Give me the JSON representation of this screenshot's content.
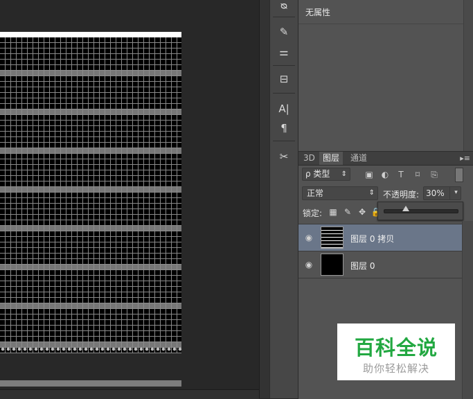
{
  "canvas": {
    "stripe_rows": 9
  },
  "tools": [
    {
      "icon": "history-brush-icon",
      "glyph": "ᴓ"
    },
    {
      "icon": "brush-presets-icon",
      "glyph": "✎"
    },
    {
      "icon": "adjust-sliders-icon",
      "glyph": "⚌"
    },
    {
      "icon": "clone-source-icon",
      "glyph": "⊟"
    },
    {
      "icon": "character-icon",
      "glyph": "A|"
    },
    {
      "icon": "paragraph-icon",
      "glyph": "¶"
    },
    {
      "icon": "tool-presets-icon",
      "glyph": "✂"
    }
  ],
  "properties": {
    "title": "无属性"
  },
  "layers_panel": {
    "tabs": [
      {
        "label": "3D",
        "active": false
      },
      {
        "label": "图层",
        "active": true
      },
      {
        "label": "通道",
        "active": false
      }
    ],
    "filter": {
      "label": "ρ 类型",
      "arrow": "⇕"
    },
    "filter_icons": [
      "image-filter-icon",
      "adjustment-filter-icon",
      "type-filter-icon",
      "shape-filter-icon",
      "smart-object-filter-icon"
    ],
    "blend_mode": {
      "value": "正常",
      "arrow": "⇕"
    },
    "opacity": {
      "label": "不透明度:",
      "value": "30%",
      "arrow": "▾",
      "fraction": 0.3
    },
    "lock": {
      "label": "锁定:"
    },
    "layers": [
      {
        "name": "图层 0 拷贝",
        "selected": true,
        "visible": true,
        "thumb": "lines"
      },
      {
        "name": "图层 0",
        "selected": false,
        "visible": true,
        "thumb": "black"
      }
    ],
    "menu_icon": "▸≡"
  },
  "watermark": {
    "title": "百科全说",
    "subtitle": "助你轻松解决"
  },
  "colors": {
    "selected_layer": "#6a7689",
    "panel_bg": "#535353",
    "watermark_green": "#22a841"
  }
}
